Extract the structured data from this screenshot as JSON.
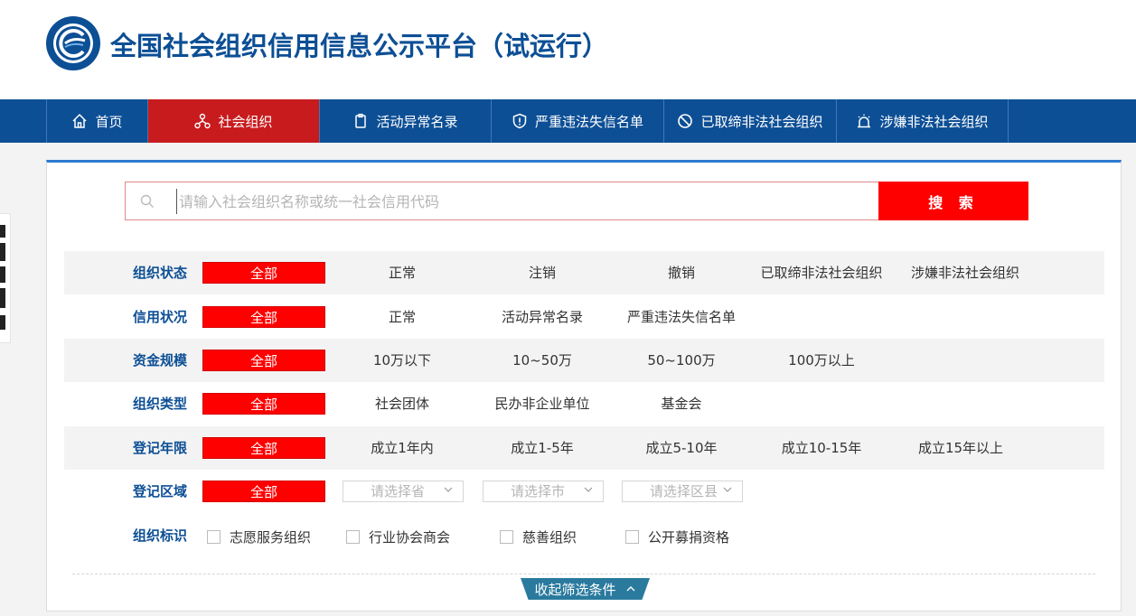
{
  "header": {
    "title": "全国社会组织信用信息公示平台（试运行）"
  },
  "nav": {
    "items": [
      {
        "label": "首页",
        "icon": "home-icon"
      },
      {
        "label": "社会组织",
        "icon": "org-network-icon",
        "active": true
      },
      {
        "label": "活动异常名录",
        "icon": "clipboard-icon"
      },
      {
        "label": "严重违法失信名单",
        "icon": "shield-alert-icon"
      },
      {
        "label": "已取缔非法社会组织",
        "icon": "ban-icon"
      },
      {
        "label": "涉嫌非法社会组织",
        "icon": "alarm-icon"
      }
    ]
  },
  "search": {
    "placeholder": "请输入社会组织名称或统一社会信用代码",
    "button_label": "搜 索"
  },
  "filters": {
    "all_label": "全部",
    "status": {
      "label": "组织状态",
      "options": [
        "正常",
        "注销",
        "撤销",
        "已取缔非法社会组织",
        "涉嫌非法社会组织"
      ]
    },
    "credit": {
      "label": "信用状况",
      "options": [
        "正常",
        "活动异常名录",
        "严重违法失信名单"
      ]
    },
    "capital": {
      "label": "资金规模",
      "options": [
        "10万以下",
        "10~50万",
        "50~100万",
        "100万以上"
      ]
    },
    "type": {
      "label": "组织类型",
      "options": [
        "社会团体",
        "民办非企业单位",
        "基金会"
      ]
    },
    "years": {
      "label": "登记年限",
      "options": [
        "成立1年内",
        "成立1-5年",
        "成立5-10年",
        "成立10-15年",
        "成立15年以上"
      ]
    },
    "region": {
      "label": "登记区域",
      "province_placeholder": "请选择省",
      "city_placeholder": "请选择市",
      "county_placeholder": "请选择区县"
    },
    "tags": {
      "label": "组织标识",
      "options": [
        "志愿服务组织",
        "行业协会商会",
        "慈善组织",
        "公开募捐资格"
      ]
    }
  },
  "collapse_label": "收起筛选条件",
  "colors": {
    "brand_blue": "#0d4f95",
    "active_red": "#c81b1e",
    "button_red": "#fe0000",
    "collapse_teal": "#2a7a9e"
  }
}
